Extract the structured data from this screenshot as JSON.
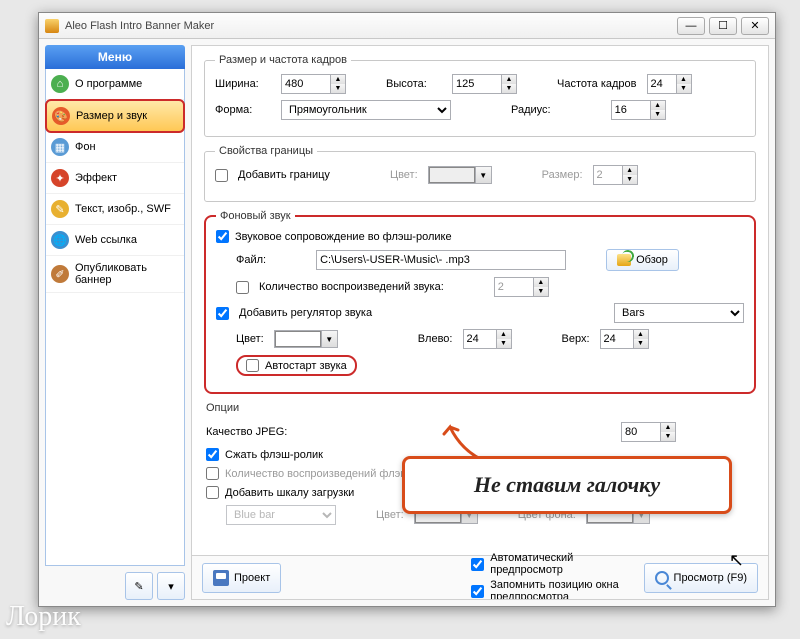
{
  "window": {
    "title": "Aleo Flash Intro Banner Maker"
  },
  "sidebar": {
    "header": "Меню",
    "items": [
      {
        "label": "О программе",
        "icon": "home",
        "color": "#4caf50"
      },
      {
        "label": "Размер и звук",
        "icon": "palette",
        "color": "#e65a2a",
        "selected": true
      },
      {
        "label": "Фон",
        "icon": "image",
        "color": "#5a9bd5"
      },
      {
        "label": "Эффект",
        "icon": "sparkle",
        "color": "#d6442a"
      },
      {
        "label": "Текст, изобр., SWF",
        "icon": "pencil",
        "color": "#e8b030"
      },
      {
        "label": "Web ссылка",
        "icon": "globe",
        "color": "#3a8fd0"
      },
      {
        "label": "Опубликовать баннер",
        "icon": "brush",
        "color": "#c07a3a"
      }
    ]
  },
  "groups": {
    "dimensions": {
      "legend": "Размер и частота кадров",
      "width_label": "Ширина:",
      "width": "480",
      "height_label": "Высота:",
      "height": "125",
      "fps_label": "Частота кадров",
      "fps": "24",
      "shape_label": "Форма:",
      "shape": "Прямоугольник",
      "radius_label": "Радиус:",
      "radius": "16"
    },
    "border": {
      "legend": "Свойства границы",
      "add_label": "Добавить границу",
      "color_label": "Цвет:",
      "size_label": "Размер:",
      "size": "2"
    },
    "sound": {
      "legend": "Фоновый звук",
      "with_sound_label": "Звуковое сопровождение во флэш-ролике",
      "file_label": "Файл:",
      "file_value": "C:\\Users\\-USER-\\Music\\- .mp3",
      "browse_label": "Обзор",
      "loops_label": "Количество воспроизведений звука:",
      "loops": "2",
      "regulator_label": "Добавить регулятор звука",
      "regulator_type": "Bars",
      "color_label": "Цвет:",
      "left_label": "Влево:",
      "left": "24",
      "top_label": "Верх:",
      "top": "24",
      "autostart_label": "Автостарт звука"
    },
    "options": {
      "legend": "Опции",
      "jpeg_label": "Качество JPEG:",
      "jpeg": "80",
      "compress_label": "Сжать флэш-ролик",
      "loops_label": "Количество воспроизведений флэш-ролика:",
      "scale_label": "Добавить шкалу загрузки",
      "scale_type": "Blue bar",
      "color_label": "Цвет:",
      "bgcolor_label": "Цвет фона:"
    }
  },
  "bottom": {
    "project_label": "Проект",
    "auto_preview_label": "Автоматический предпросмотр",
    "remember_pos_label": "Запомнить позицию окна предпросмотра",
    "preview_label": "Просмотр (F9)"
  },
  "callout": "Не ставим галочку",
  "watermark": "Лорик"
}
